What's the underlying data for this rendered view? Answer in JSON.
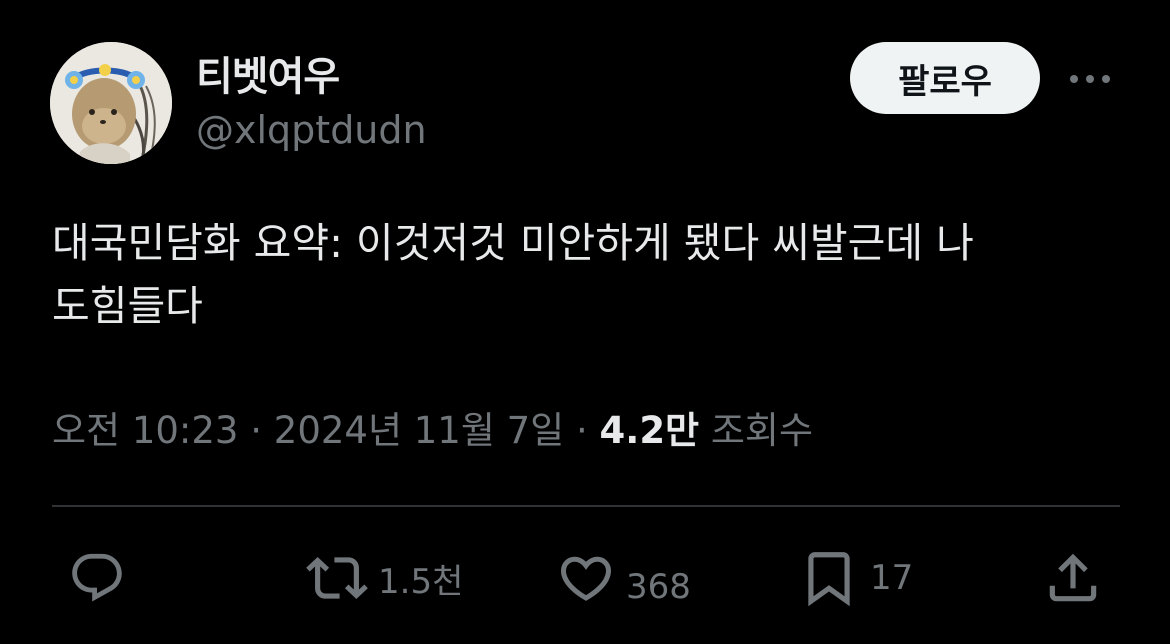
{
  "author": {
    "display_name": "티벳여우",
    "handle": "@xlqptdudn"
  },
  "follow_label": "팔로우",
  "more_icon": "more-horizontal-icon",
  "tweet": {
    "text": "대국민담화 요약: 이것저것 미안하게 됐다 씨발근데 나\n도힘들다"
  },
  "meta": {
    "time": "오전 10:23",
    "separator": "·",
    "date": "2024년 11월 7일",
    "views_count": "4.2만",
    "views_label": "조회수"
  },
  "actions": {
    "reply": {
      "icon": "reply-icon",
      "count": ""
    },
    "retweet": {
      "icon": "retweet-icon",
      "count": "1.5천"
    },
    "like": {
      "icon": "heart-icon",
      "count": "368"
    },
    "bookmark": {
      "icon": "bookmark-icon",
      "count": "17"
    },
    "share": {
      "icon": "share-icon",
      "count": ""
    }
  },
  "colors": {
    "background": "#000000",
    "primary_text": "#e7e9ea",
    "secondary_text": "#71767b",
    "divider": "#2f3336",
    "follow_button_bg": "#eff3f4"
  }
}
